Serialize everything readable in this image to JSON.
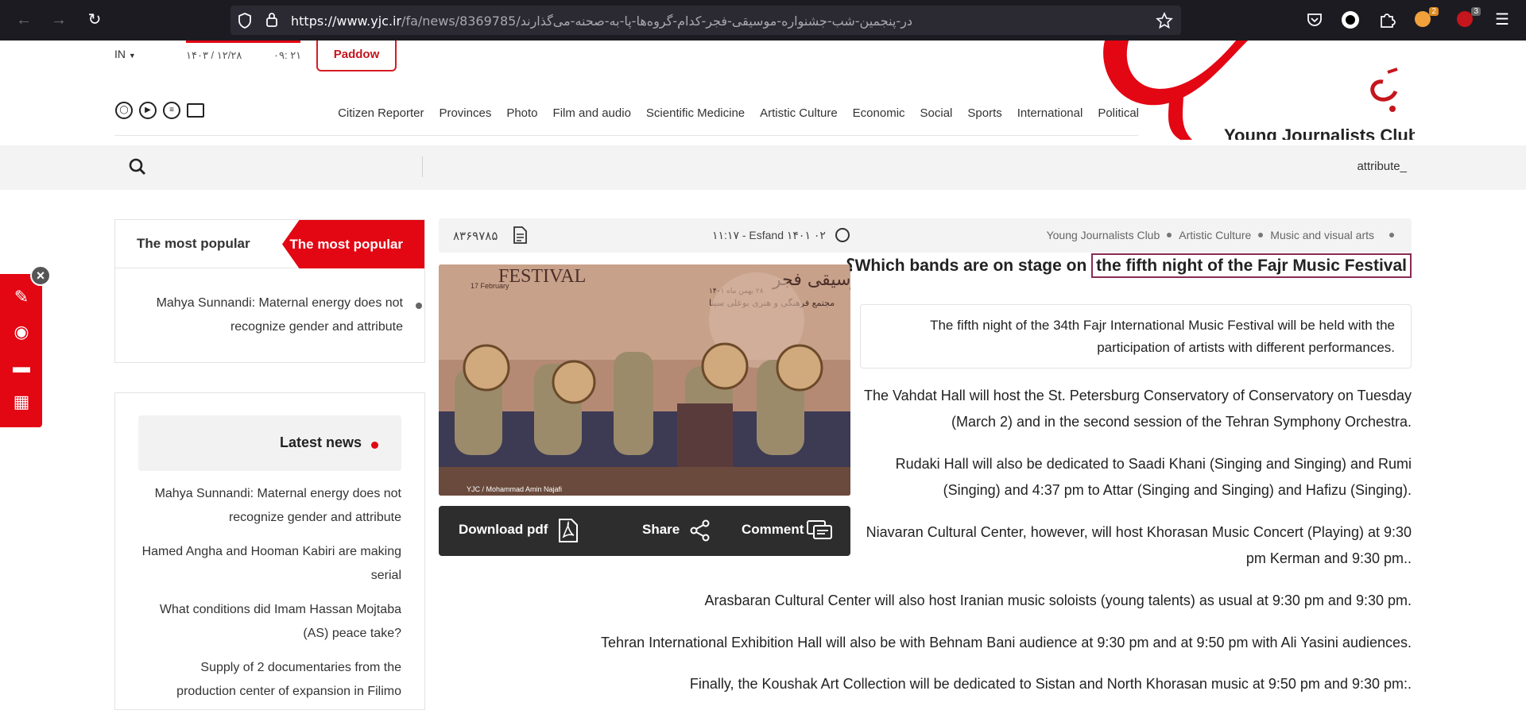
{
  "browser": {
    "url_host": "https://www.yjc.ir",
    "url_path": "/fa/news/8369785/در-پنجمین-شب-جشنواره-موسیقی-فجر-کدام-گروه‌ها-پا-به-صحنه-می‌گذارند",
    "ext_badge_1": "2",
    "ext_badge_2": "3"
  },
  "header": {
    "lang": "IN",
    "date": "۱۴۰۳ / ۱۲/۲۸",
    "time": "۰۹: ۲۱",
    "paddow": "Paddow",
    "logo_text": "Young Journalists Club",
    "nav": [
      "Citizen Reporter",
      "Provinces",
      "Photo",
      "Film and audio",
      "Scientific Medicine",
      "Artistic Culture",
      "Economic",
      "Social",
      "Sports",
      "International",
      "Political"
    ]
  },
  "strip": {
    "ticker": "attribute_"
  },
  "popular": {
    "tab_inactive": "The most popular",
    "tab_active": "The most popular",
    "item": "Mahya Sunnandi: Maternal energy does not recognize gender and attribute"
  },
  "latest": {
    "title": "Latest news",
    "items": [
      "Mahya Sunnandi: Maternal energy does not recognize gender and attribute",
      "Hamed Angha and Hooman Kabiri are making serial",
      "What conditions did Imam Hassan Mojtaba (AS) peace take?",
      "Supply of 2 documentaries from the production center of expansion in Filimo"
    ]
  },
  "article": {
    "id": "۸۳۶۹۷۸۵",
    "datetime": "۱۱:۱۷ - Esfand ۱۴۰۱ ۰۲",
    "crumbs": [
      "Young Journalists Club",
      "Artistic Culture",
      "Music and visual arts"
    ],
    "title_pre": "Which bands are on stage on ",
    "title_hl": "the fifth night of the Fajr Music Festival",
    "title_q": "؟",
    "lead": "The fifth night of the 34th Fajr International Music Festival will be held with the participation of artists with different performances.",
    "paragraphs": [
      "The Vahdat Hall will host the St. Petersburg Conservatory of Conservatory on Tuesday (March 2) and in the second session of the Tehran Symphony Orchestra.",
      "Rudaki Hall will also be dedicated to Saadi Khani (Singing and Singing) and Rumi (Singing) and 4:37 pm to Attar (Singing and Singing) and Hafizu (Singing).",
      "Niavaran Cultural Center, however, will host Khorasan Music Concert (Playing) at 9:30 pm Kerman and 9:30 pm..",
      "Arasbaran Cultural Center will also host Iranian music soloists (young talents) as usual at 9:30 pm and 9:30 pm.",
      "Tehran International Exhibition Hall will also be with Behnam Bani audience at 9:30 pm and at 9:50 pm with Ali Yasini audiences.",
      "Finally, the Koushak Art Collection will be dedicated to Sistan and North Khorasan music at 9:50 pm and 9:30 pm:."
    ],
    "image_caption": "YJC / Mohammad Amin Najafi",
    "poster_festival": "FESTIVAL",
    "poster_date": "17 February",
    "poster_fa_title": "موسیقی فجر",
    "poster_fa_line1": "۲۸ بهمن ماه ۱۴۰۱",
    "poster_fa_line2": "مجتمع فرهنگی و هنری بوعلی سینا",
    "actions": {
      "pdf": "Download pdf",
      "share": "Share",
      "comment": "Comment"
    }
  },
  "colors": {
    "brand_red": "#e30613",
    "chrome_bg": "#1c1b22",
    "highlight": "#8a2a53"
  }
}
